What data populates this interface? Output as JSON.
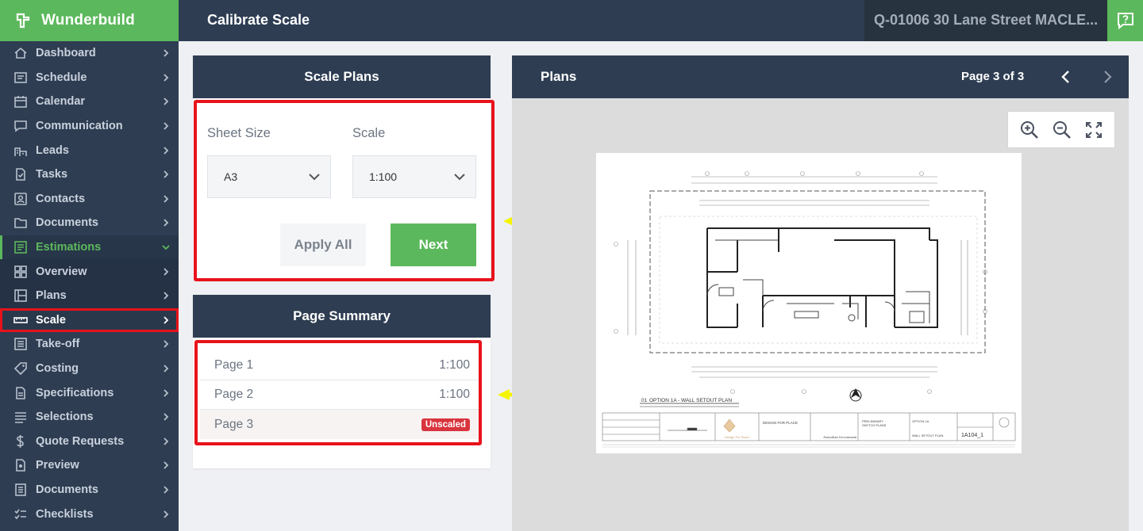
{
  "brand": {
    "name": "Wunderbuild"
  },
  "topbar": {
    "title": "Calibrate Scale",
    "quote": "Q-01006 30 Lane Street MACLE..."
  },
  "sidebar": {
    "items": [
      {
        "label": "Dashboard",
        "icon": "home-icon"
      },
      {
        "label": "Schedule",
        "icon": "schedule-icon"
      },
      {
        "label": "Calendar",
        "icon": "calendar-icon"
      },
      {
        "label": "Communication",
        "icon": "chat-icon"
      },
      {
        "label": "Leads",
        "icon": "leads-icon"
      },
      {
        "label": "Tasks",
        "icon": "tasks-icon"
      },
      {
        "label": "Contacts",
        "icon": "contacts-icon"
      },
      {
        "label": "Documents",
        "icon": "folder-icon"
      },
      {
        "label": "Estimations",
        "icon": "estimations-icon"
      },
      {
        "label": "Overview",
        "icon": "grid-icon"
      },
      {
        "label": "Plans",
        "icon": "plans-icon"
      },
      {
        "label": "Scale",
        "icon": "ruler-icon"
      },
      {
        "label": "Take-off",
        "icon": "takeoff-icon"
      },
      {
        "label": "Costing",
        "icon": "tag-icon"
      },
      {
        "label": "Specifications",
        "icon": "specifications-icon"
      },
      {
        "label": "Selections",
        "icon": "list-icon"
      },
      {
        "label": "Quote Requests",
        "icon": "dollar-icon"
      },
      {
        "label": "Preview",
        "icon": "preview-icon"
      },
      {
        "label": "Documents",
        "icon": "documents-icon"
      },
      {
        "label": "Checklists",
        "icon": "checklist-icon"
      }
    ]
  },
  "scale_plans": {
    "title": "Scale Plans",
    "sheet_size_label": "Sheet Size",
    "sheet_size_value": "A3",
    "scale_label": "Scale",
    "scale_value": "1:100",
    "apply_all_label": "Apply All",
    "next_label": "Next"
  },
  "page_summary": {
    "title": "Page Summary",
    "rows": [
      {
        "page": "Page 1",
        "scale": "1:100"
      },
      {
        "page": "Page 2",
        "scale": "1:100"
      },
      {
        "page": "Page 3",
        "badge": "Unscaled"
      }
    ]
  },
  "plans": {
    "title": "Plans",
    "page_indicator": "Page 3 of 3",
    "plan_caption": "OPTION 1A - WALL SETOUT PLAN",
    "drawing_number": "1A104_1"
  },
  "colors": {
    "sidebar": "#2e3d52",
    "accent_green": "#5cb85c",
    "highlight_red": "#e8121b",
    "badge_red": "#d9343e",
    "arrow_yellow": "#f5f500"
  }
}
